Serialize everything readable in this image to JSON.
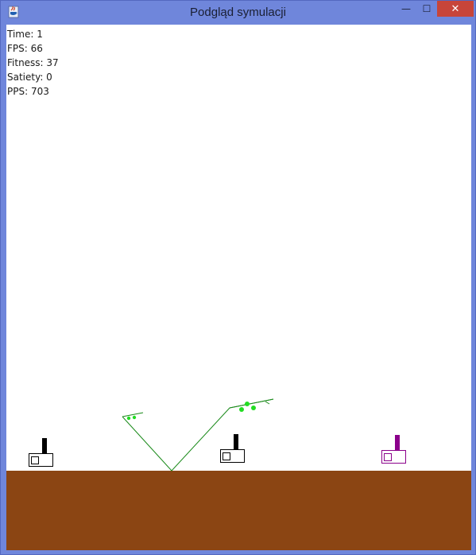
{
  "window": {
    "title": "Podgląd symulacji",
    "minimize_label": "—",
    "maximize_label": "☐",
    "close_label": "✕",
    "app_icon": "java-cup-icon"
  },
  "stats": {
    "time": "Time: 1",
    "fps": "FPS: 66",
    "fitness": "Fitness: 37",
    "satiety": "Satiety: 0",
    "pps": "PPS: 703"
  },
  "colors": {
    "ground": "#8b4513",
    "plant": "#1a8a1a",
    "food": "#22dd22",
    "tank_default": "#000000",
    "tank_selected": "#8b008b",
    "titlebar": "#6f86db",
    "close_button": "#c7453a"
  },
  "scene": {
    "tanks": [
      {
        "id": "tank-1",
        "color": "#000000"
      },
      {
        "id": "tank-2",
        "color": "#000000"
      },
      {
        "id": "tank-3",
        "color": "#8b008b"
      }
    ]
  }
}
